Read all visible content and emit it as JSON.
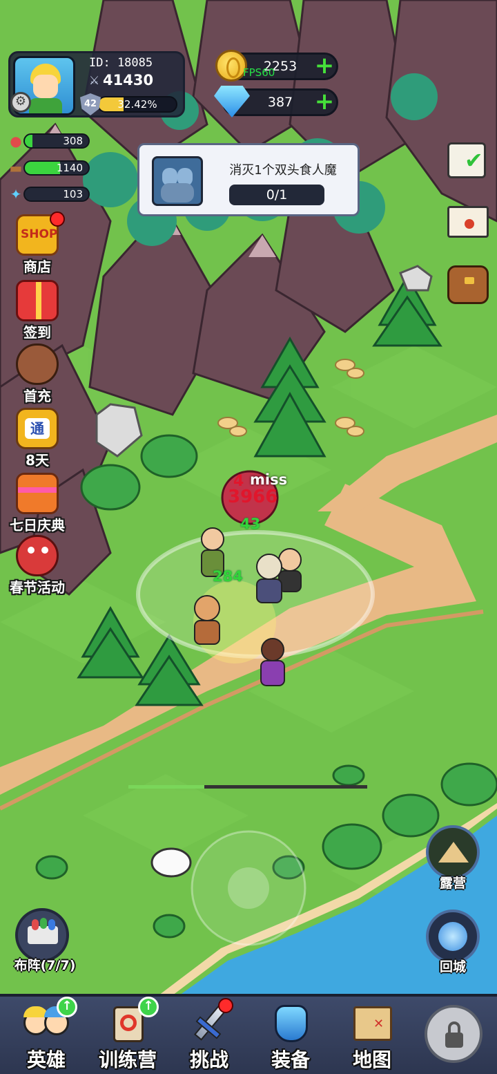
{
  "player": {
    "id_label": "ID: 18085",
    "power": "41430",
    "level": "42",
    "exp_text": "32.42%",
    "exp_fraction": 0.3242
  },
  "currency": {
    "gold": "2253",
    "gems": "387",
    "fps_label": "FPS60"
  },
  "resources": [
    {
      "icon": "meat-icon",
      "value": "308",
      "fill": 0.12,
      "color": "#3bd43f"
    },
    {
      "icon": "wood-icon",
      "value": "1140",
      "fill": 0.55,
      "color": "#3bd43f"
    },
    {
      "icon": "crystal-icon",
      "value": "103",
      "fill": 0.0,
      "color": "#3bd43f"
    }
  ],
  "quest": {
    "title": "消灭1个双头食人魔",
    "progress": "0/1"
  },
  "side_menu": [
    {
      "label": "商店",
      "icon": "shop-icon",
      "badge": true
    },
    {
      "label": "签到",
      "icon": "gift-icon",
      "badge": false
    },
    {
      "label": "首充",
      "icon": "archer-icon",
      "badge": false
    },
    {
      "label": "8天",
      "icon": "pass-icon",
      "badge": false
    },
    {
      "label": "七日庆典",
      "icon": "celebration-gift-icon",
      "badge": false
    },
    {
      "label": "春节活动",
      "icon": "lion-dance-icon",
      "badge": false
    }
  ],
  "right_menu": [
    {
      "icon": "checklist-icon"
    },
    {
      "icon": "mail-icon"
    },
    {
      "icon": "backpack-icon"
    }
  ],
  "combat": {
    "miss_text": "miss",
    "damage_red": "3966",
    "damage_small": "4",
    "heal_1": "43",
    "heal_2": "284"
  },
  "map_buttons": {
    "camp": "露营",
    "return": "回城",
    "formation": "布阵(7/7)"
  },
  "tabs": [
    {
      "label": "英雄",
      "icon": "heroes-icon",
      "upgrade": true,
      "badge": false,
      "locked": false
    },
    {
      "label": "训练营",
      "icon": "training-camp-icon",
      "upgrade": true,
      "badge": false,
      "locked": false
    },
    {
      "label": "挑战",
      "icon": "sword-icon",
      "upgrade": false,
      "badge": true,
      "locked": false
    },
    {
      "label": "装备",
      "icon": "armor-icon",
      "upgrade": false,
      "badge": false,
      "locked": false
    },
    {
      "label": "地图",
      "icon": "treasure-map-icon",
      "upgrade": false,
      "badge": false,
      "locked": false
    },
    {
      "label": "",
      "icon": "lock-icon",
      "upgrade": false,
      "badge": false,
      "locked": true
    }
  ],
  "colors": {
    "grass": "#72c24c",
    "path": "#e8b985",
    "water": "#3fa8e0",
    "mountain": "#6b4a55",
    "panel": "#22283a"
  }
}
